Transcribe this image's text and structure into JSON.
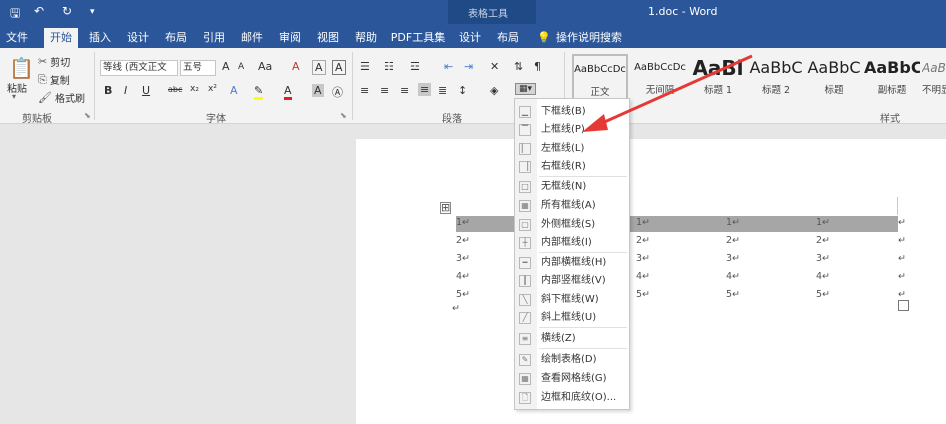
{
  "titlebar": {
    "title": "1.doc - Word",
    "context_group": "表格工具",
    "save_icon": "save-icon",
    "undo_icon": "undo-icon",
    "redo_icon": "redo-icon",
    "customize_icon": "customize-qat-icon"
  },
  "tabs": [
    "文件",
    "开始",
    "插入",
    "设计",
    "布局",
    "引用",
    "邮件",
    "审阅",
    "视图",
    "帮助",
    "PDF工具集",
    "设计",
    "布局"
  ],
  "active_tab": "开始",
  "tell_me": "操作说明搜索",
  "clipboard": {
    "paste": "粘贴",
    "cut": "剪切",
    "copy": "复制",
    "format_painter": "格式刷",
    "label": "剪贴板"
  },
  "font": {
    "name": "等线 (西文正文",
    "size": "五号",
    "label": "字体",
    "bold": "B",
    "italic": "I",
    "underline": "U",
    "strike": "abc",
    "sub": "x₂",
    "sup": "x²",
    "grow": "A",
    "shrink": "A",
    "case": "Aa",
    "clear": "A",
    "char_a": "A",
    "char_b": "A"
  },
  "paragraph": {
    "label": "段落"
  },
  "styles": {
    "label": "样式",
    "items": [
      {
        "preview": "AaBbCcDc",
        "name": "正文"
      },
      {
        "preview": "AaBbCcDc",
        "name": "无间隔"
      },
      {
        "preview": "AaBl",
        "name": "标题 1"
      },
      {
        "preview": "AaBbC",
        "name": "标题 2"
      },
      {
        "preview": "AaBbC",
        "name": "标题"
      },
      {
        "preview": "AaBbC",
        "name": "副标题"
      },
      {
        "preview": "AaBl",
        "name": "不明显"
      }
    ]
  },
  "table": {
    "rows": [
      [
        "1↵",
        "1↵",
        "1↵",
        "1↵"
      ],
      [
        "2↵",
        "2↵",
        "2↵",
        "2↵"
      ],
      [
        "3↵",
        "3↵",
        "3↵",
        "3↵"
      ],
      [
        "4↵",
        "4↵",
        "4↵",
        "4↵"
      ],
      [
        "5↵",
        "5↵",
        "5↵",
        "5↵"
      ]
    ],
    "end_marks": [
      "↵",
      "↵",
      "↵",
      "↵",
      "↵"
    ],
    "para_mark": "↵",
    "move_handle": "⊞"
  },
  "border_menu": {
    "items": [
      {
        "label": "下框线(B)",
        "icon": "bottom-border-icon"
      },
      {
        "label": "上框线(P)",
        "icon": "top-border-icon"
      },
      {
        "label": "左框线(L)",
        "icon": "left-border-icon"
      },
      {
        "label": "右框线(R)",
        "icon": "right-border-icon"
      },
      {
        "label": "无框线(N)",
        "icon": "no-border-icon"
      },
      {
        "label": "所有框线(A)",
        "icon": "all-borders-icon"
      },
      {
        "label": "外侧框线(S)",
        "icon": "outside-borders-icon"
      },
      {
        "label": "内部框线(I)",
        "icon": "inside-borders-icon"
      },
      {
        "label": "内部横框线(H)",
        "icon": "inside-horizontal-border-icon"
      },
      {
        "label": "内部竖框线(V)",
        "icon": "inside-vertical-border-icon"
      },
      {
        "label": "斜下框线(W)",
        "icon": "diagonal-down-border-icon"
      },
      {
        "label": "斜上框线(U)",
        "icon": "diagonal-up-border-icon"
      },
      {
        "label": "横线(Z)",
        "icon": "horizontal-line-icon"
      },
      {
        "label": "绘制表格(D)",
        "icon": "draw-table-icon"
      },
      {
        "label": "查看网格线(G)",
        "icon": "view-gridlines-icon"
      },
      {
        "label": "边框和底纹(O)...",
        "icon": "borders-shading-icon"
      }
    ]
  },
  "colors": {
    "accent": "#2b579a",
    "arrow": "#e53935"
  }
}
